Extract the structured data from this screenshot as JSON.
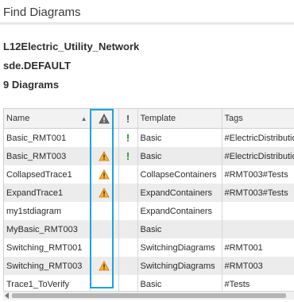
{
  "title": "Find Diagrams",
  "info": {
    "database": "L12Electric_Utility_Network",
    "version": "sde.DEFAULT",
    "count": "9 Diagrams"
  },
  "columns": {
    "name": "Name",
    "warning_icon": "warning-icon",
    "exclamation": "!",
    "template": "Template",
    "tags": "Tags"
  },
  "rows": [
    {
      "name": "Basic_RMT001",
      "warning": false,
      "inconsistent": true,
      "template": "Basic",
      "tags": "#ElectricDistribution"
    },
    {
      "name": "Basic_RMT003",
      "warning": true,
      "inconsistent": true,
      "template": "Basic",
      "tags": "#ElectricDistribution"
    },
    {
      "name": "CollapsedTrace1",
      "warning": true,
      "inconsistent": false,
      "template": "CollapseContainers",
      "tags": "#RMT003#Tests"
    },
    {
      "name": "ExpandTrace1",
      "warning": true,
      "inconsistent": false,
      "template": "ExpandContainers",
      "tags": "#RMT003#Tests"
    },
    {
      "name": "my1stdiagram",
      "warning": false,
      "inconsistent": false,
      "template": "ExpandContainers",
      "tags": ""
    },
    {
      "name": "MyBasic_RMT003",
      "warning": false,
      "inconsistent": false,
      "template": "Basic",
      "tags": ""
    },
    {
      "name": "Switching_RMT001",
      "warning": false,
      "inconsistent": false,
      "template": "SwitchingDiagrams",
      "tags": "#RMT001"
    },
    {
      "name": "Switching_RMT003",
      "warning": true,
      "inconsistent": false,
      "template": "SwitchingDiagrams",
      "tags": "#RMT003"
    },
    {
      "name": "Trace1_ToVerify",
      "warning": false,
      "inconsistent": false,
      "template": "Basic",
      "tags": "#Tests"
    }
  ],
  "colors": {
    "highlight": "#1aa4df",
    "warning_fill": "#f5b041",
    "inconsistent_mark": "#2d8a2d"
  }
}
